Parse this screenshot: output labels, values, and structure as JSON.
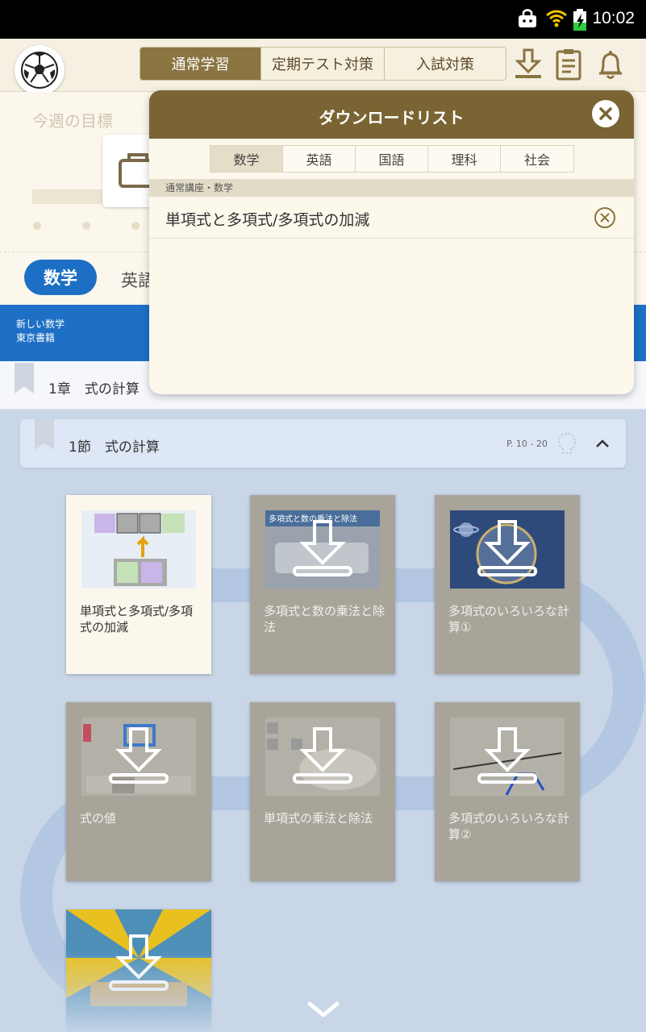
{
  "status_bar": {
    "time": "10:02",
    "icons": [
      "bag-icon",
      "wifi-icon",
      "battery-charging-icon"
    ]
  },
  "header": {
    "logo_icon": "soccer-ball-icon",
    "tabs": [
      {
        "label": "通常学習",
        "active": true
      },
      {
        "label": "定期テスト対策",
        "active": false
      },
      {
        "label": "入試対策",
        "active": false
      }
    ],
    "icons": [
      "download-icon",
      "clipboard-icon",
      "bell-icon"
    ]
  },
  "goal": {
    "title": "今週の目標"
  },
  "subjects": {
    "active": "数学",
    "next": "英語"
  },
  "textbook": {
    "line1": "新しい数学",
    "line2": "東京書籍"
  },
  "chapter": {
    "label": "1章　式の計算"
  },
  "section": {
    "label": "1節　式の計算",
    "pages": "P. 10 - 20"
  },
  "cards": [
    {
      "title": "単項式と多項式/多項式の加減",
      "downloaded": true
    },
    {
      "title": "多項式と数の乗法と除法",
      "downloaded": false,
      "thumb_text": "多項式と数の乗法と除法"
    },
    {
      "title": "多項式のいろいろな計算①",
      "downloaded": false
    },
    {
      "title": "式の値",
      "downloaded": false
    },
    {
      "title": "単項式の乗法と除法",
      "downloaded": false
    },
    {
      "title": "多項式のいろいろな計算②",
      "downloaded": false
    },
    {
      "title": "",
      "downloaded": false
    }
  ],
  "colors": {
    "accent_brown": "#7a6433",
    "blue": "#1e70c6",
    "card_gray": "#a9a499"
  },
  "modal": {
    "title": "ダウンロードリスト",
    "tabs": [
      {
        "label": "数学",
        "active": true
      },
      {
        "label": "英語",
        "active": false
      },
      {
        "label": "国語",
        "active": false
      },
      {
        "label": "理科",
        "active": false
      },
      {
        "label": "社会",
        "active": false
      }
    ],
    "group_label": "通常講座・数学",
    "items": [
      {
        "label": "単項式と多項式/多項式の加減"
      }
    ]
  }
}
